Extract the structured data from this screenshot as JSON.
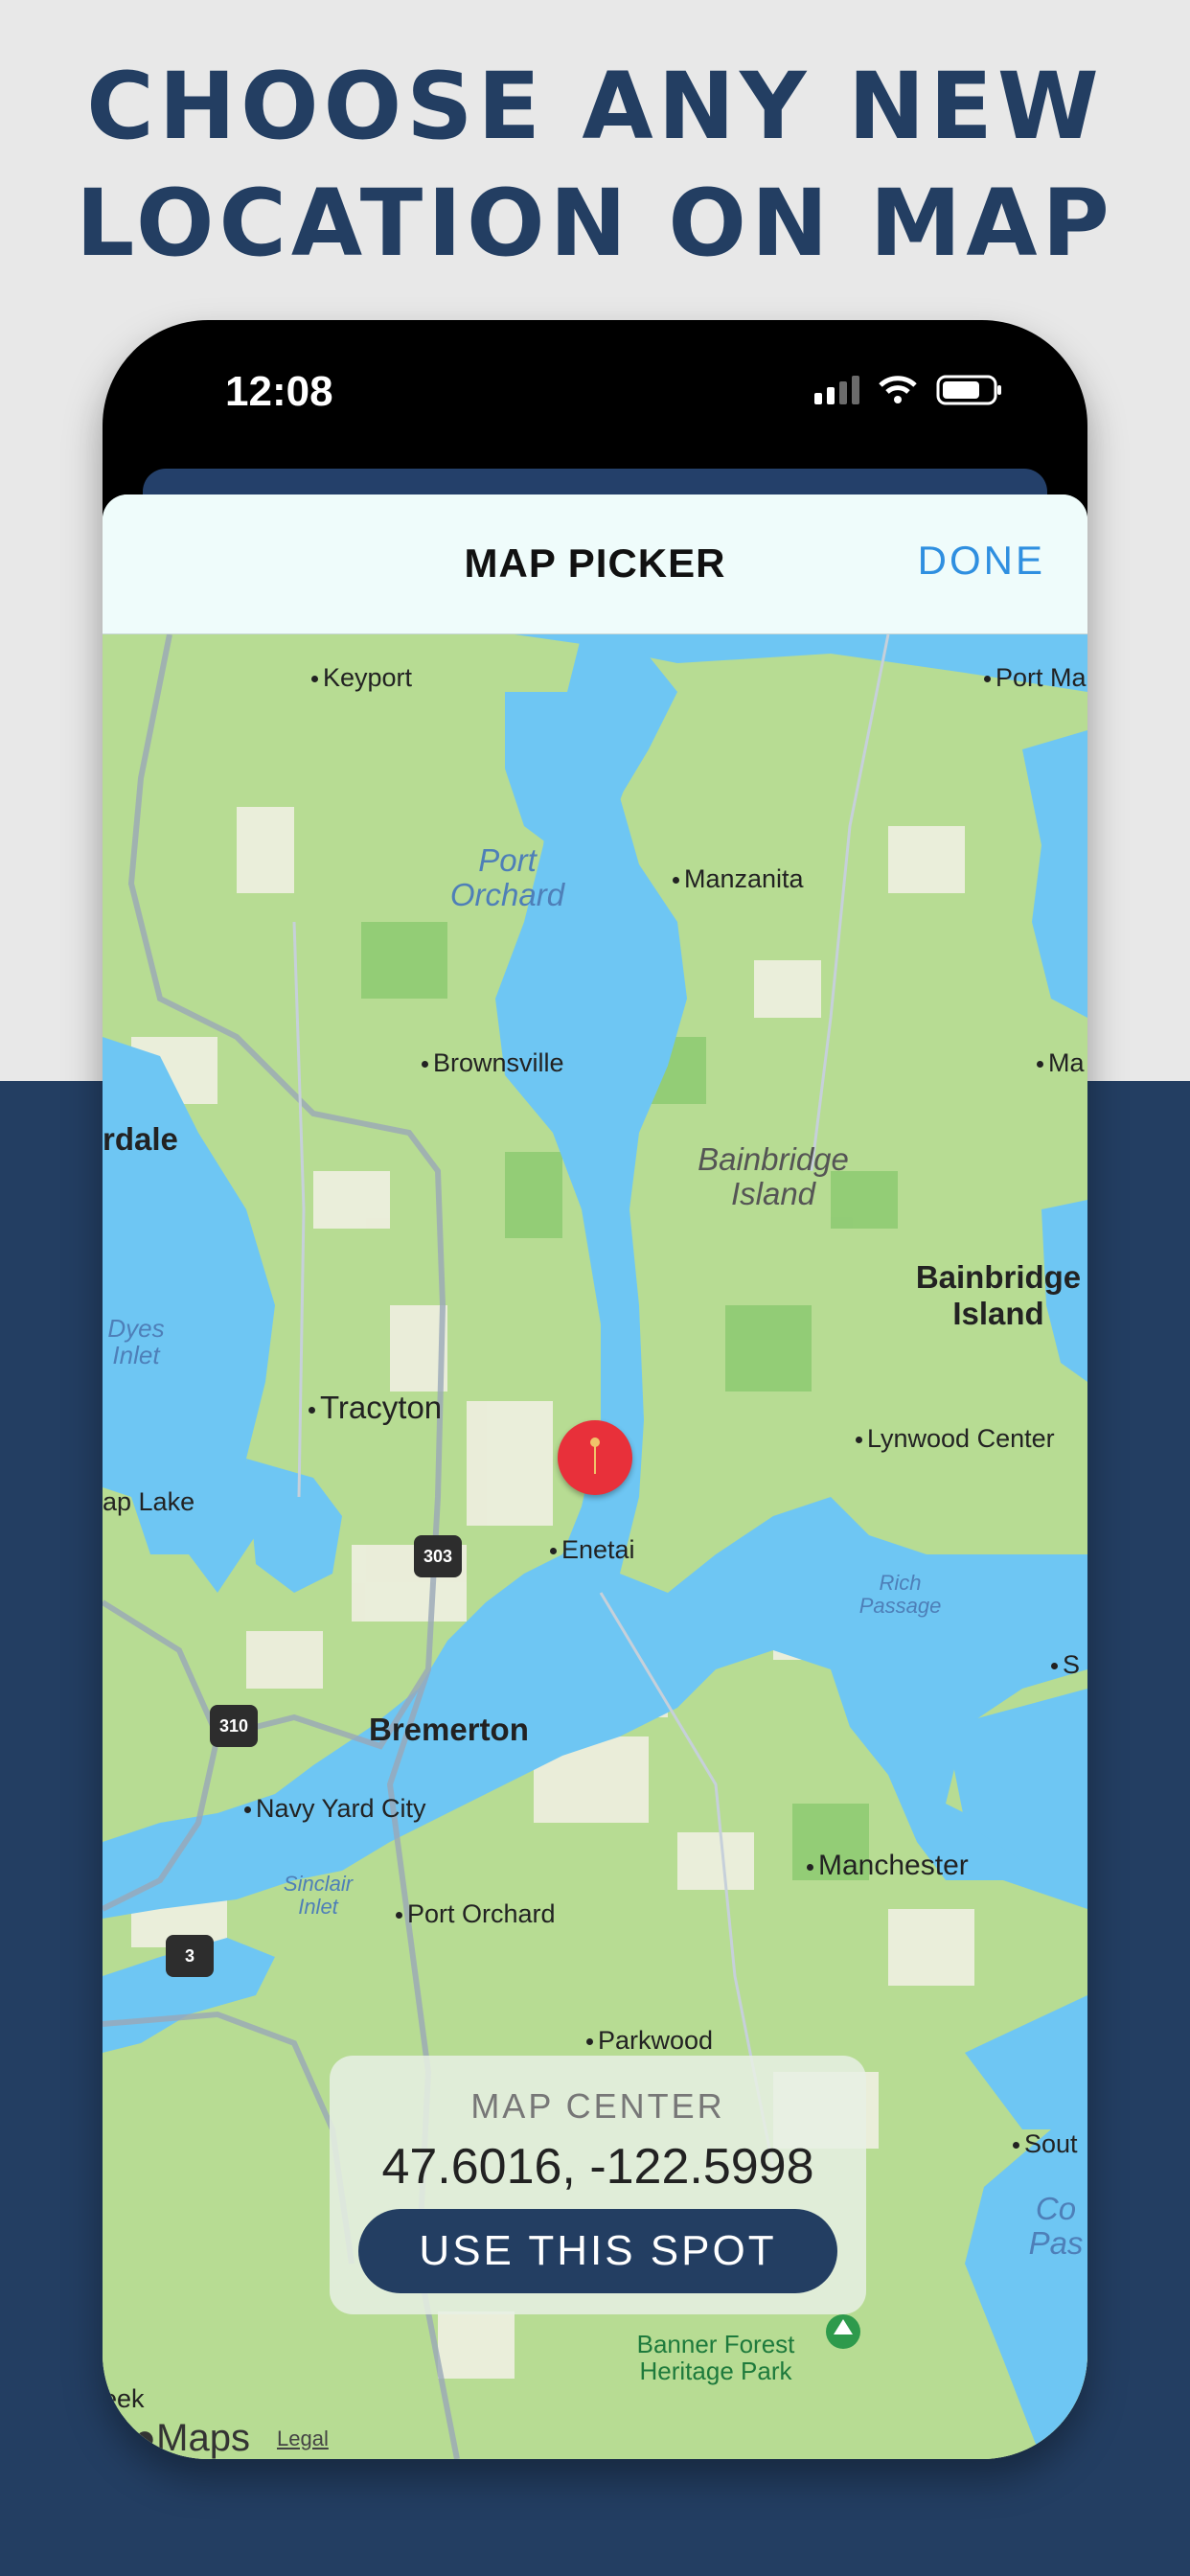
{
  "headline": {
    "line1": "CHOOSE ANY NEW",
    "line2": "LOCATION ON MAP"
  },
  "status_bar": {
    "time": "12:08"
  },
  "navbar": {
    "title": "MAP PICKER",
    "done_label": "DONE"
  },
  "map": {
    "labels": {
      "keyport": "Keyport",
      "port_madison": "Port Ma",
      "port_orchard_bay_1": "Port",
      "port_orchard_bay_2": "Orchard",
      "manzanita": "Manzanita",
      "brownsville": "Brownsville",
      "ma_edge": "Ma",
      "rdale": "rdale",
      "bainbridge_island_area_1": "Bainbridge",
      "bainbridge_island_area_2": "Island",
      "bainbridge_island_city_1": "Bainbridge",
      "bainbridge_island_city_2": "Island",
      "dyes_inlet_1": "Dyes",
      "dyes_inlet_2": "Inlet",
      "tracyton": "Tracyton",
      "lynwood_center": "Lynwood Center",
      "ap_lake": "ap Lake",
      "enetai": "Enetai",
      "rich_passage_1": "Rich",
      "rich_passage_2": "Passage",
      "s_edge": "S",
      "bremerton": "Bremerton",
      "navy_yard_city": "Navy Yard City",
      "manchester": "Manchester",
      "sinclair_inlet_1": "Sinclair",
      "sinclair_inlet_2": "Inlet",
      "port_orchard_city": "Port Orchard",
      "parkwood": "Parkwood",
      "south_edge": "Sout",
      "co_edge_1": "Co",
      "co_edge_2": "Pas",
      "banner_forest_1": "Banner Forest",
      "banner_forest_2": "Heritage Park",
      "eek": "eek"
    },
    "shields": {
      "sr303": "303",
      "sr310": "310",
      "sr3": "3"
    },
    "attribution": "Maps",
    "legal": "Legal"
  },
  "center_card": {
    "label": "MAP CENTER",
    "coordinates": "47.6016, -122.5998",
    "button_label": "USE THIS SPOT"
  },
  "colors": {
    "navy": "#233e62",
    "land": "#b7dc93",
    "water": "#6ec6f3",
    "pin": "#e8303a",
    "done": "#2f8fe0"
  }
}
